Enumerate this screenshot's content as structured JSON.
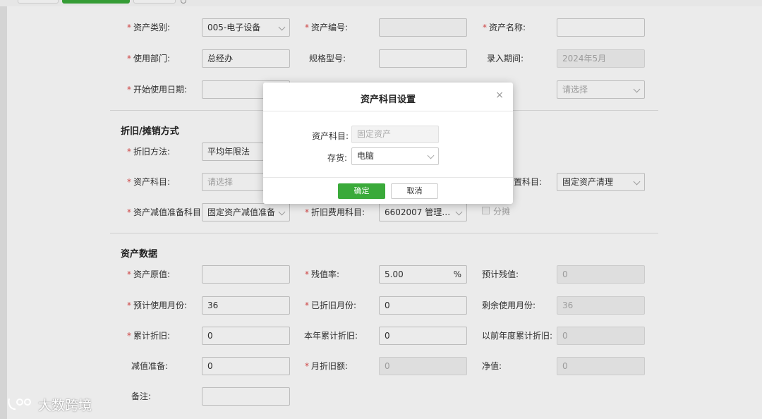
{
  "top_tabs": [
    "",
    "",
    ""
  ],
  "basic": {
    "asset_category_label": "资产类别:",
    "asset_category_value": "005-电子设备",
    "asset_number_label": "资产编号:",
    "asset_number_value": "",
    "asset_name_label": "资产名称:",
    "asset_name_value": "",
    "dept_label": "使用部门:",
    "dept_value": "总经办",
    "spec_label": "规格型号:",
    "spec_value": "",
    "entry_period_label": "录入期间:",
    "entry_period_value": "2024年5月",
    "start_date_label": "开始使用日期:",
    "start_date_value": "",
    "third_select_placeholder": "请选择"
  },
  "depreciation": {
    "section_title": "折旧/摊销方式",
    "method_label": "折旧方法:",
    "method_value": "平均年限法",
    "asset_subject_label": "资产科目:",
    "asset_subject_placeholder": "请选择",
    "disposal_subject_label": "置科目:",
    "disposal_subject_value": "固定资产清理",
    "impairment_label": "资产减值准备科目:",
    "impairment_value": "固定资产减值准备",
    "expense_label": "折旧费用科目:",
    "expense_value": "6602007 管理…",
    "share_label": "分摊"
  },
  "asset_data": {
    "section_title": "资产数据",
    "original_label": "资产原值:",
    "original_value": "",
    "residual_rate_label": "残值率:",
    "residual_rate_value": "5.00",
    "residual_rate_unit": "%",
    "est_residual_label": "预计残值:",
    "est_residual_value": "0",
    "est_months_label": "预计使用月份:",
    "est_months_value": "36",
    "dep_months_label": "已折旧月份:",
    "dep_months_value": "0",
    "remain_months_label": "剩余使用月份:",
    "remain_months_value": "36",
    "accum_label": "累计折旧:",
    "accum_value": "0",
    "year_accum_label": "本年累计折旧:",
    "year_accum_value": "0",
    "prev_accum_label": "以前年度累计折旧:",
    "prev_accum_value": "0",
    "impair_label": "减值准备:",
    "impair_value": "0",
    "monthly_label": "月折旧额:",
    "monthly_value": "0",
    "net_label": "净值:",
    "net_value": "0",
    "remark_label": "备注:",
    "remark_value": ""
  },
  "modal": {
    "title": "资产科目设置",
    "close": "×",
    "subject_label": "资产科目:",
    "subject_value": "固定资产",
    "inventory_label": "存货:",
    "inventory_value": "电脑",
    "ok": "确定",
    "cancel": "取消"
  },
  "watermark": "大数跨境",
  "colors": {
    "accent": "#3aaa3a",
    "required": "#e04b4b"
  }
}
